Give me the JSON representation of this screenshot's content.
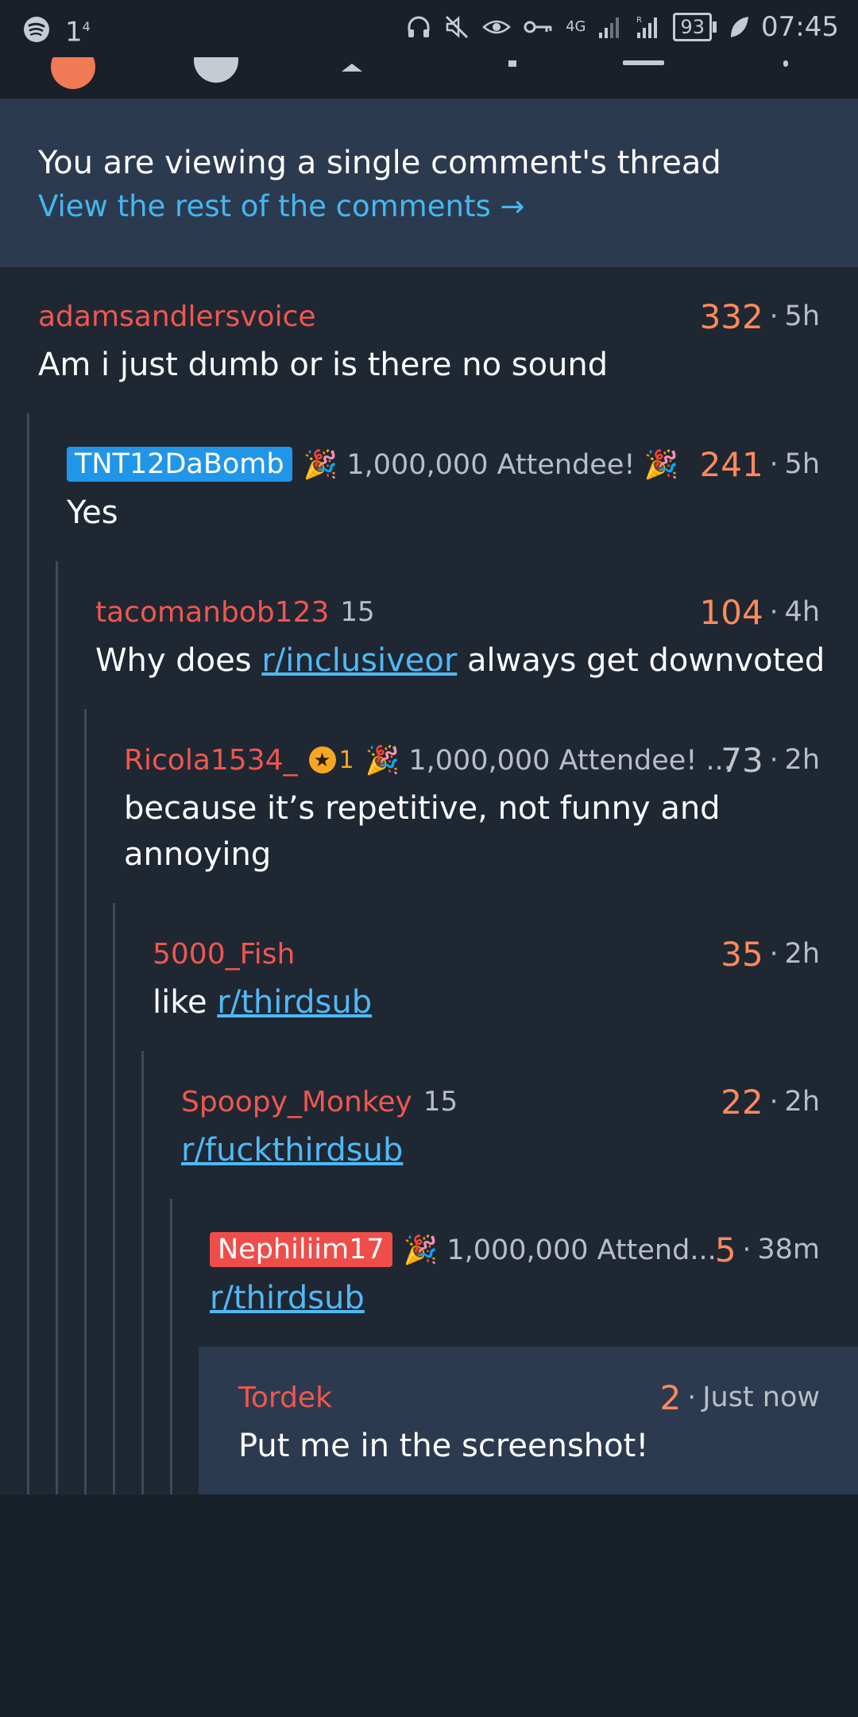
{
  "status_bar": {
    "left_indicator": "1",
    "left_superscript": "4",
    "network": "4G",
    "battery": "93",
    "time": "07:45",
    "icons": [
      "spotify-icon",
      "headphones-icon",
      "mute-icon",
      "eye-icon",
      "key-icon",
      "signal-icon",
      "signal-roaming-icon",
      "battery-icon",
      "leaf-icon"
    ]
  },
  "banner": {
    "message": "You are viewing a single comment's thread",
    "link_text": "View the rest of the comments →"
  },
  "comments": [
    {
      "author": "adamsandlersvoice",
      "score": "332",
      "time": "5h",
      "body": "Am i just dumb or is there no sound"
    },
    {
      "author": "TNT12DaBomb",
      "author_style": "op-badge",
      "flair": "🎉 1,000,000 Attendee! 🎉",
      "score": "241",
      "time": "5h",
      "body": "Yes"
    },
    {
      "author": "tacomanbob123",
      "karma": "15",
      "score": "104",
      "time": "4h",
      "body_before": "Why does ",
      "body_link": "r/inclusiveor",
      "body_after": " always get downvoted"
    },
    {
      "author": "Ricola1534_",
      "award_count": "1",
      "flair": "🎉 1,000,000 Attendee! ...",
      "score": "73",
      "time": "2h",
      "body_line1": "because it’s repetitive, not funny and",
      "body_line2": "annoying"
    },
    {
      "author": "5000_Fish",
      "score": "35",
      "time": "2h",
      "body_before": "like ",
      "body_link": "r/thirdsub"
    },
    {
      "author": "Spoopy_Monkey",
      "karma": "15",
      "score": "22",
      "time": "2h",
      "body_link": "r/fuckthirdsub"
    },
    {
      "author": "Nephiliim17",
      "author_style": "mod-badge",
      "flair": "🎉 1,000,000 Attend...",
      "score": "5",
      "time": "38m",
      "body_link": "r/thirdsub"
    },
    {
      "author": "Tordek",
      "score": "2",
      "time": "Just now",
      "body": "Put me in the screenshot!"
    }
  ],
  "separator": "·",
  "colors": {
    "author": "#f0574e",
    "score": "#ff8a5c",
    "link": "#43b8f0",
    "banner_bg": "#2c3a4f",
    "thread_bg": "#1f2733"
  }
}
